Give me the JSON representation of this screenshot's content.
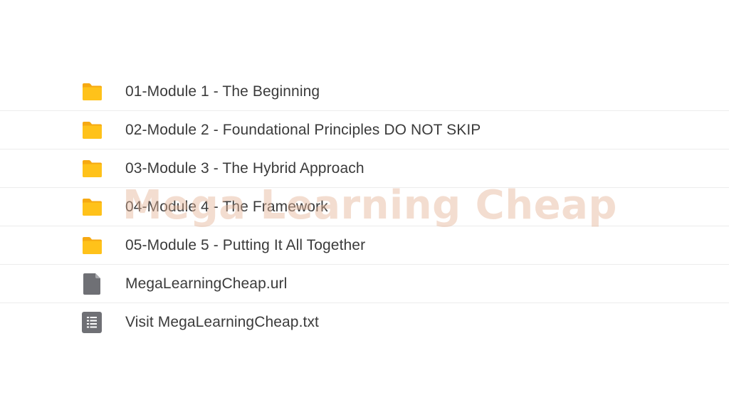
{
  "files": [
    {
      "name": "01-Module 1 - The Beginning",
      "icon": "folder-icon"
    },
    {
      "name": "02-Module 2 - Foundational Principles DO NOT SKIP",
      "icon": "folder-icon"
    },
    {
      "name": "03-Module 3 - The Hybrid Approach",
      "icon": "folder-icon"
    },
    {
      "name": "04-Module 4 - The Framework",
      "icon": "folder-icon"
    },
    {
      "name": "05-Module 5 - Putting It All Together",
      "icon": "folder-icon"
    },
    {
      "name": "MegaLearningCheap.url",
      "icon": "link-file-icon"
    },
    {
      "name": "Visit MegaLearningCheap.txt",
      "icon": "text-file-icon"
    }
  ],
  "watermark": "Mega Learning Cheap",
  "colors": {
    "folder": "#FFC21A",
    "file_icon": "#6f7075",
    "text": "#3b3b3b",
    "divider": "#ececec",
    "watermark": "#E5B496"
  }
}
